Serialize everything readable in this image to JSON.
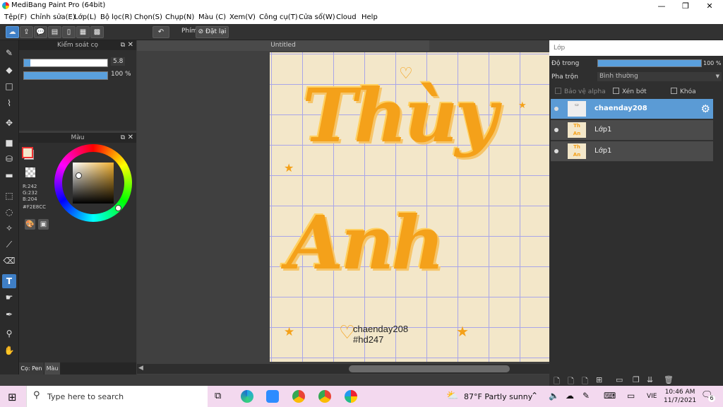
{
  "window": {
    "title": "MediBang Paint Pro (64bit)",
    "minimize": "—",
    "maximize": "❐",
    "close": "✕"
  },
  "menu": [
    "Tệp(F)",
    "Chỉnh sửa(E)",
    "Lớp(L)",
    "Bộ lọc(R)",
    "Chọn(S)",
    "Chụp(N)",
    "Màu (C)",
    "Xem(V)",
    "Công cụ(T)",
    "Cửa sổ(W)",
    "Cloud",
    "Help"
  ],
  "toolbar": {
    "shortcut_label": "Phím",
    "reset_label": "Đặt lại"
  },
  "brush_panel": {
    "title": "Kiểm soát cọ",
    "size_value": "5.8",
    "opacity_value": "100 %",
    "size_fraction": 0.08,
    "opacity_fraction": 1.0
  },
  "color_panel": {
    "title": "Màu",
    "r": "R:242",
    "g": "G:232",
    "b": "B:204",
    "hex": "#F2E8CC",
    "current_color": "#F2E8CC"
  },
  "bottom_tabs": [
    "Cọ: Pen",
    "Màu"
  ],
  "document": {
    "tab_title": "Untitled",
    "text_line1": "Thùy",
    "text_line2": "Anh",
    "credit1": "chaenday208",
    "credit2": "#hd247"
  },
  "layer_panel": {
    "title": "Lớp",
    "opacity_label": "Độ trong",
    "opacity_value": "100 %",
    "opacity_fraction": 1.0,
    "blend_label": "Pha trộn",
    "blend_value": "Bình thường",
    "protect_alpha": "Bảo vệ alpha",
    "clip": "Xén bớt",
    "lock": "Khóa",
    "layers": [
      {
        "name": "chaenday208",
        "selected": true
      },
      {
        "name": "Lớp1",
        "selected": false
      },
      {
        "name": "Lớp1",
        "selected": false
      }
    ]
  },
  "taskbar": {
    "search_placeholder": "Type here to search",
    "weather": "87°F  Partly sunny",
    "lang": "VIE",
    "time": "10:46 AM",
    "date": "11/7/2021",
    "notifications": "6"
  },
  "colors": {
    "accent": "#3F7FC6",
    "selected_layer": "#5B9BD5",
    "canvas_bg": "#F3E7C9",
    "text_orange": "#F4A11A"
  }
}
